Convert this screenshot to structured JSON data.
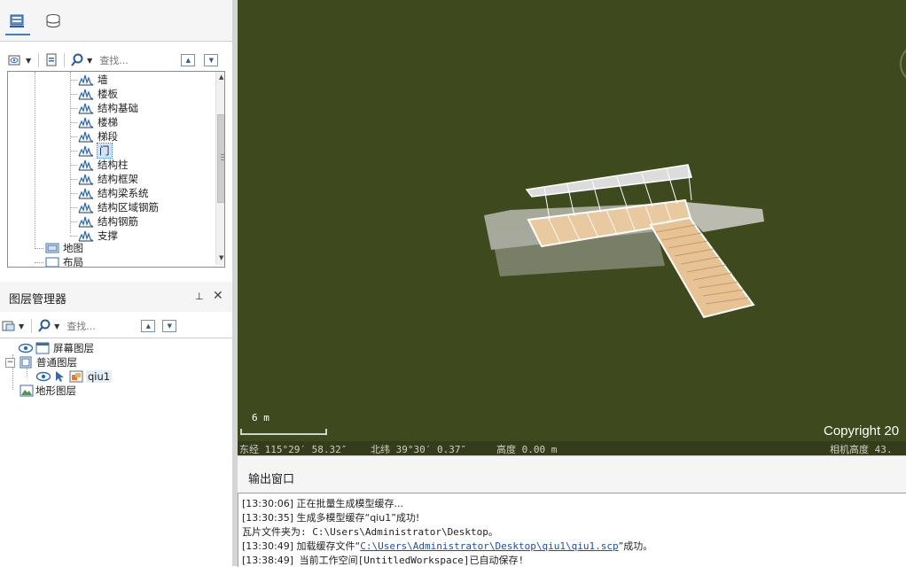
{
  "workspace_panel": {
    "search_placeholder": "查找...",
    "tree_items": [
      {
        "label": "墙"
      },
      {
        "label": "楼板"
      },
      {
        "label": "结构基础"
      },
      {
        "label": "楼梯"
      },
      {
        "label": "梯段"
      },
      {
        "label": "门"
      },
      {
        "label": "结构柱"
      },
      {
        "label": "结构框架"
      },
      {
        "label": "结构梁系统"
      },
      {
        "label": "结构区域钢筋"
      },
      {
        "label": "结构钢筋"
      },
      {
        "label": "支撑"
      }
    ],
    "map_label": "地图",
    "layout_label": "布局"
  },
  "layer_manager": {
    "title": "图层管理器",
    "search_placeholder": "查找...",
    "screen_layer": "屏幕图层",
    "normal_layer": "普通图层",
    "layer_item": "qiu1",
    "terrain_layer": "地形图层"
  },
  "scene": {
    "scale_label": "6 m",
    "status_longitude": "东经 115°29′ 58.32″",
    "status_latitude": "北纬 39°30′ 0.37″",
    "status_altitude": "高度 0.00 m",
    "status_camera": "相机高度 43.",
    "copyright": "Copyright 20",
    "background_color": "#3e4a1d"
  },
  "output_window": {
    "title": "输出窗口",
    "log": [
      {
        "time": "[13:30:06]",
        "text": " 正在批量生成模型缓存..."
      },
      {
        "time": "[13:30:35]",
        "text": " 生成多模型缓存“qiu1”成功!"
      },
      {
        "time": "",
        "text": "瓦片文件夹为: C:\\Users\\Administrator\\Desktop。"
      },
      {
        "time": "[13:30:49]",
        "text_before": " 加载缓存文件“",
        "link": "C:\\Users\\Administrator\\Desktop\\qiu1\\qiu1.scp",
        "text_after": "”成功。"
      },
      {
        "time": "[13:38:49]",
        "text": " 当前工作空间[UntitledWorkspace]已自动保存!"
      }
    ]
  }
}
